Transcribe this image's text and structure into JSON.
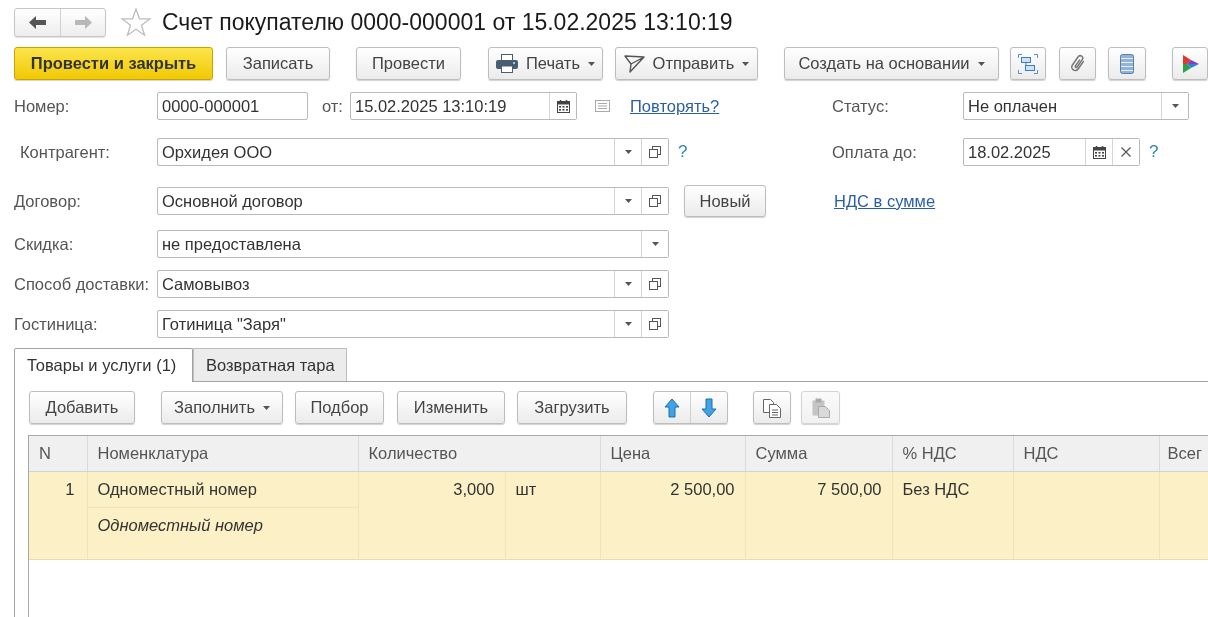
{
  "window": {
    "title": "Счет покупателю 0000-000001 от 15.02.2025 13:10:19",
    "favorite": false
  },
  "navigation": [
    {
      "disabled": false
    },
    {
      "disabled": true
    }
  ],
  "toolbar": [
    {
      "label": "Провести и закрыть",
      "kind": "default"
    },
    {
      "label": "Записать",
      "kind": "plain"
    },
    {
      "label": "Провести",
      "kind": "plain"
    },
    {
      "label": "Печать",
      "kind": "menu"
    },
    {
      "label": "Отправить",
      "kind": "menu"
    },
    {
      "label": "Создать на основании",
      "kind": "menu"
    }
  ],
  "form": {
    "number": {
      "label": "Номер:",
      "value": "0000-000001"
    },
    "date": {
      "label": "от:",
      "value": "15.02.2025 13:10:19"
    },
    "repeat_link": "Повторять?",
    "status": {
      "label": "Статус:",
      "value": "Не оплачен"
    },
    "counterparty": {
      "label": "Контрагент:",
      "value": "Орхидея ООО",
      "help": "?"
    },
    "pay_by": {
      "label": "Оплата до:",
      "value": "18.02.2025",
      "help": "?"
    },
    "contract": {
      "label": "Договор:",
      "value": "Основной договор",
      "button": "Новый"
    },
    "vat_link": "НДС в сумме",
    "discount": {
      "label": "Скидка:",
      "value": "не предоставлена"
    },
    "delivery": {
      "label": "Способ доставки:",
      "value": "Самовывоз"
    },
    "hotel": {
      "label": "Гостиница:",
      "value": "Готиница \"Заря\""
    }
  },
  "tabs": [
    {
      "label": "Товары и услуги (1)",
      "selected": true
    },
    {
      "label": "Возвратная тара",
      "selected": false
    }
  ],
  "table_toolbar": [
    {
      "label": "Добавить",
      "kind": "plain"
    },
    {
      "label": "Заполнить",
      "kind": "menu"
    },
    {
      "label": "Подбор",
      "kind": "plain"
    },
    {
      "label": "Изменить",
      "kind": "plain"
    },
    {
      "label": "Загрузить",
      "kind": "plain"
    }
  ],
  "row_buttons": [
    {
      "disabled": false
    },
    {
      "disabled": true
    }
  ],
  "table": {
    "columns": [
      "N",
      "Номенклатура",
      "Количество",
      "Цена",
      "Сумма",
      "% НДС",
      "НДС",
      "Всег"
    ],
    "rows": [
      {
        "selected": true,
        "n": "1",
        "item": "Одноместный номер",
        "content": "Одноместный номер",
        "quantity": "3,000",
        "unit": "шт",
        "price": "2 500,00",
        "amount": "7 500,00",
        "vat_rate": "Без НДС"
      }
    ]
  }
}
